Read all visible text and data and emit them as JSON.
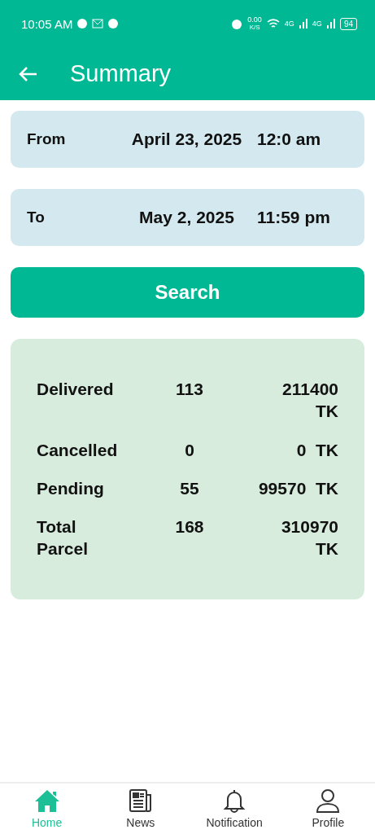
{
  "status_bar": {
    "time": "10:05 AM",
    "speed": "0.00",
    "speed_unit": "K/S",
    "network_1": "4G",
    "network_2": "4G",
    "battery": "94"
  },
  "header": {
    "title": "Summary"
  },
  "date_range": [
    {
      "label": "From",
      "date": "April 23, 2025",
      "time": "12:0 am"
    },
    {
      "label": "To",
      "date": "May 2, 2025",
      "time": "11:59 pm"
    }
  ],
  "search_button": "Search",
  "summary": [
    {
      "label": "Delivered",
      "count": "113",
      "amount": "211400 TK"
    },
    {
      "label": "Cancelled",
      "count": "0",
      "amount": "0  TK"
    },
    {
      "label": "Pending",
      "count": "55",
      "amount": "99570  TK"
    },
    {
      "label": "Total Parcel",
      "count": "168",
      "amount": "310970 TK"
    }
  ],
  "bottom_nav": [
    {
      "label": "Home",
      "kind": "home",
      "selected": true
    },
    {
      "label": "News",
      "kind": "news",
      "selected": false
    },
    {
      "label": "Notification",
      "kind": "bell",
      "selected": false
    },
    {
      "label": "Profile",
      "kind": "user",
      "selected": false
    }
  ]
}
